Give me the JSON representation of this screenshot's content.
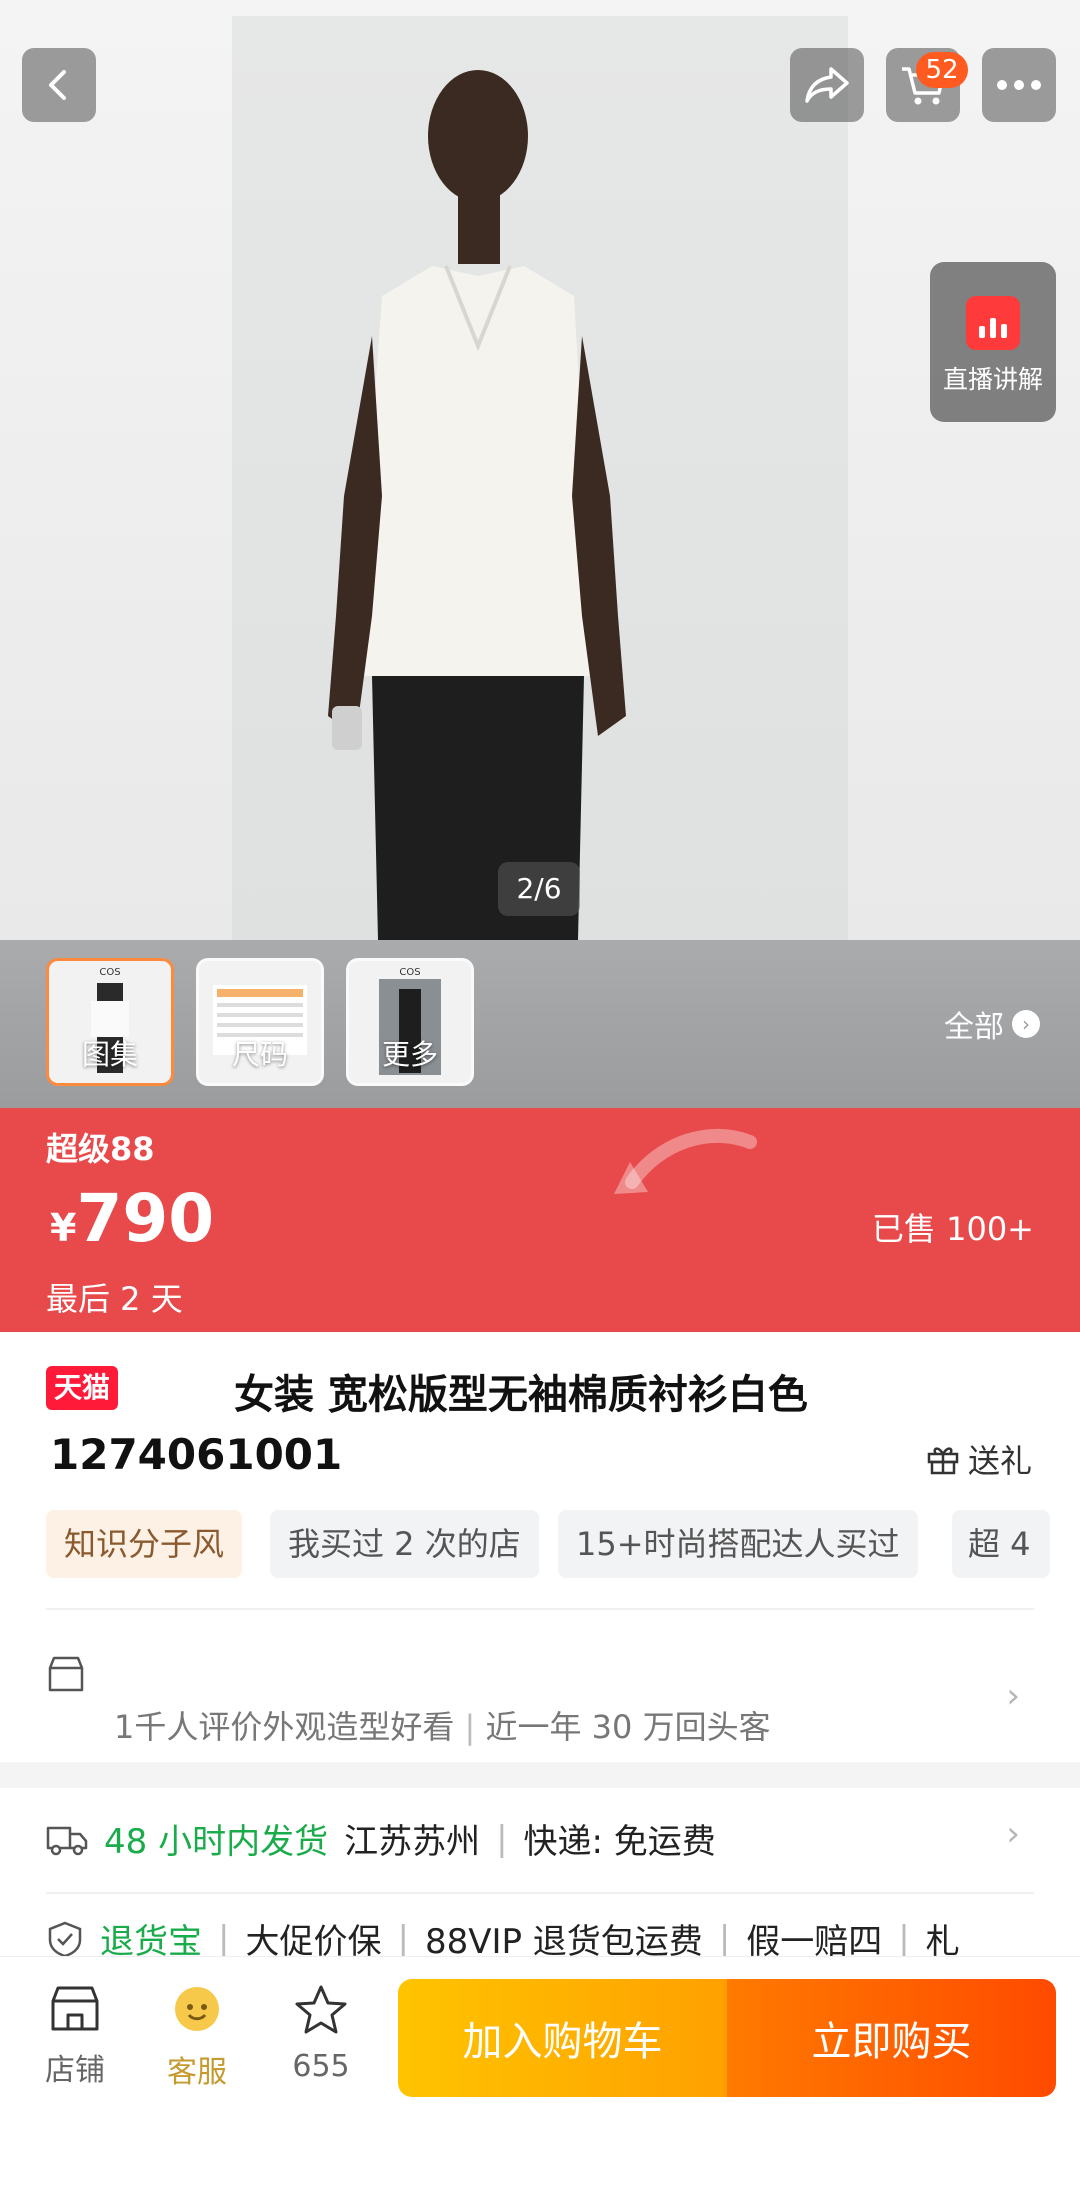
{
  "hero": {
    "page_indicator": "2/6",
    "cart_badge": "52",
    "live_label": "直播讲解"
  },
  "thumbnails": [
    {
      "label": "图集",
      "brand": "COS"
    },
    {
      "label": "尺码",
      "brand": ""
    },
    {
      "label": "更多",
      "brand": "COS"
    }
  ],
  "thumb_all": "全部",
  "price_banner": {
    "title": "超级88",
    "currency": "¥",
    "price": "790",
    "countdown": "最后 2 天",
    "sold": "已售 100+"
  },
  "product": {
    "badge": "天猫",
    "title_line1": "女装 宽松版型无袖棉质衬衫白色",
    "title_line2": "1274061001",
    "gift": "送礼",
    "tags": [
      "知识分子风",
      "我买过 2 次的店",
      "15+时尚搭配达人买过",
      "超 4"
    ]
  },
  "shop": {
    "subtitle_part1": "1千人评价外观造型好看",
    "subtitle_part2": "近一年 30 万回头客"
  },
  "shipping": {
    "delivery": "48 小时内发货",
    "location": "江苏苏州",
    "express": "快递:  免运费"
  },
  "service": {
    "items": [
      "退货宝",
      "大促价保",
      "88VIP 退货包运费",
      "假一赔四",
      "札"
    ]
  },
  "bottom_bar": {
    "shop_label": "店铺",
    "service_label": "客服",
    "fav_count": "655",
    "add_cart": "加入购物车",
    "buy_now": "立即购买"
  },
  "colors": {
    "price_banner_bg": "#e84a4b",
    "cart_btn": "#ffb400",
    "buy_btn": "#ff5a00",
    "tmall_red": "#ff1a3a"
  }
}
